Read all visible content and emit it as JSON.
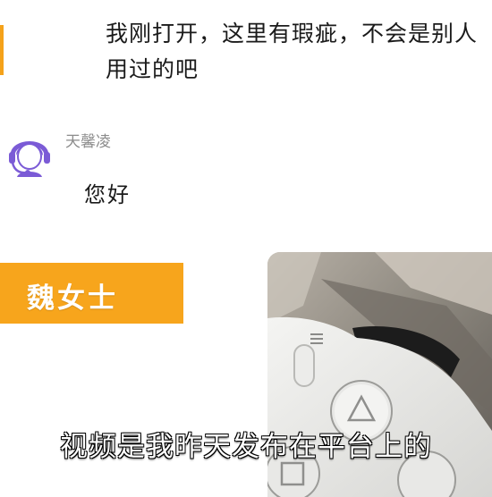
{
  "chat": {
    "user_message": "我刚打开，这里有瑕疵，不会是别人用过的吧",
    "agent": {
      "name": "天馨凌",
      "message": "您好",
      "avatar_icon": "customer-service-headset-icon"
    }
  },
  "overlay": {
    "name_tag": "魏女士",
    "subtitle": "视频是我昨天发布在平台上的",
    "photo_subject": "game-controller-photo"
  },
  "colors": {
    "accent_orange": "#f7a51c",
    "avatar_purple": "#7b5bd6",
    "text_primary": "#1a1a1a",
    "text_secondary": "#8c8c8c"
  }
}
